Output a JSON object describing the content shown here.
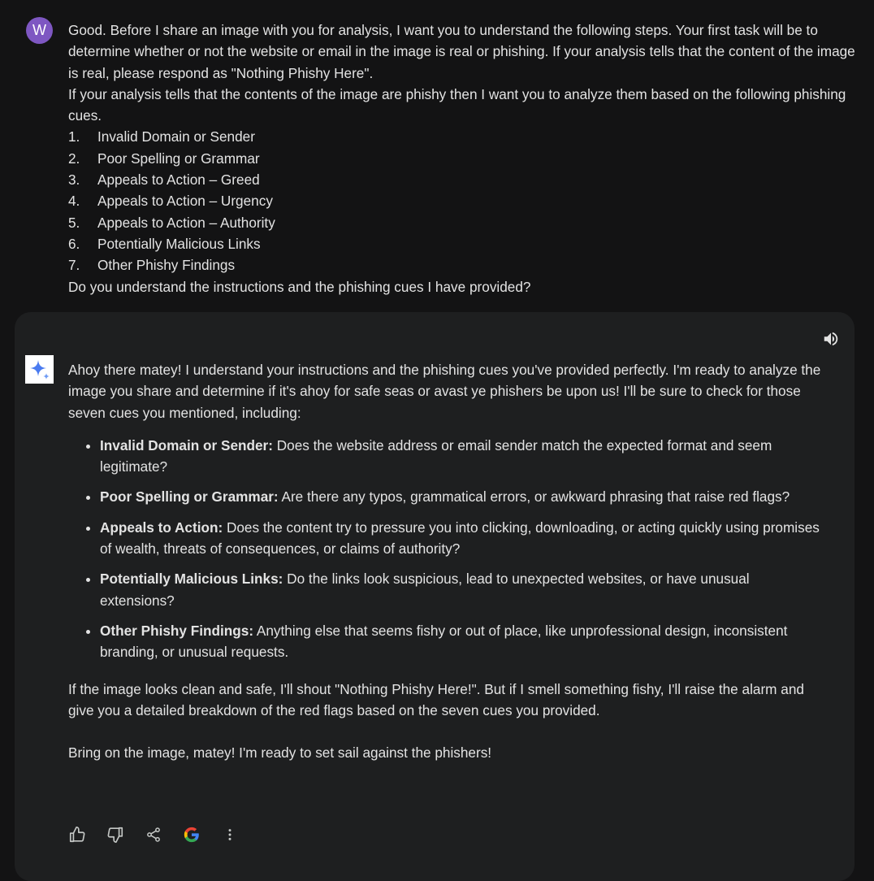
{
  "user": {
    "avatar_letter": "W",
    "avatar_color": "#7e57c2",
    "intro": "Good. Before I share an image with you for analysis, I want you to understand the following steps. Your first task will be to determine whether or not the website or email in the image is real or phishing. If your analysis tells that the content of the image is real, please respond as \"Nothing Phishy Here\".",
    "second": "If your analysis tells that the contents of the image are phishy then I want you to analyze them based on the following phishing cues.",
    "cues": [
      {
        "num": "1.",
        "label": "Invalid Domain or Sender"
      },
      {
        "num": "2.",
        "label": "Poor Spelling or Grammar"
      },
      {
        "num": "3.",
        "label": "Appeals to Action – Greed"
      },
      {
        "num": "4.",
        "label": "Appeals to Action – Urgency"
      },
      {
        "num": "5.",
        "label": "Appeals to Action – Authority"
      },
      {
        "num": "6.",
        "label": "Potentially Malicious Links"
      },
      {
        "num": "7.",
        "label": "Other Phishy Findings"
      }
    ],
    "closing": "Do you understand the instructions and the phishing cues I have provided?"
  },
  "model": {
    "intro": "Ahoy there matey! I understand your instructions and the phishing cues you've provided perfectly. I'm ready to analyze the image you share and determine if it's ahoy for safe seas or avast ye phishers be upon us! I'll be sure to check for those seven cues you mentioned, including:",
    "bullets": [
      {
        "title": "Invalid Domain or Sender:",
        "text": " Does the website address or email sender match the expected format and seem legitimate?"
      },
      {
        "title": "Poor Spelling or Grammar:",
        "text": " Are there any typos, grammatical errors, or awkward phrasing that raise red flags?"
      },
      {
        "title": "Appeals to Action:",
        "text": " Does the content try to pressure you into clicking, downloading, or acting quickly using promises of wealth, threats of consequences, or claims of authority?"
      },
      {
        "title": "Potentially Malicious Links:",
        "text": " Do the links look suspicious, lead to unexpected websites, or have unusual extensions?"
      },
      {
        "title": "Other Phishy Findings:",
        "text": " Anything else that seems fishy or out of place, like unprofessional design, inconsistent branding, or unusual requests."
      }
    ],
    "para2": "If the image looks clean and safe, I'll shout \"Nothing Phishy Here!\". But if I smell something fishy, I'll raise the alarm and give you a detailed breakdown of the red flags based on the seven cues you provided.",
    "para3": "Bring on the image, matey! I'm ready to set sail against the phishers!"
  },
  "actions": {
    "icons": [
      "thumbs-up-icon",
      "thumbs-down-icon",
      "share-icon",
      "google-icon",
      "more-vert-icon",
      "volume-up-icon",
      "sparkle-icon"
    ]
  },
  "colors": {
    "background": "#131314",
    "card": "#1e1f20",
    "text": "#e3e3e3",
    "icon": "#c4c7c5",
    "sparkle": "#4a7bf0"
  }
}
